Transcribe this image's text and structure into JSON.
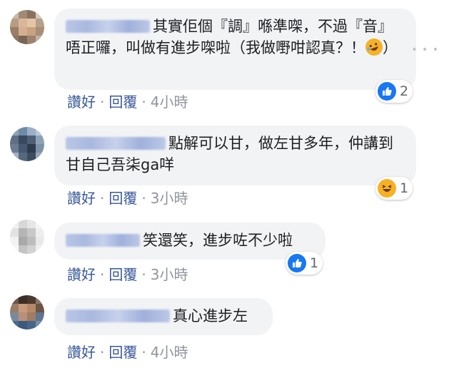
{
  "comments": [
    {
      "text": "其實佢個『調』喺準㗎，不過『音』唔正囉，叫做有進步㗎啦（我做嘢咁認真？！",
      "text_end": "）",
      "actions": {
        "like": "讚好",
        "reply": "回覆",
        "time": "4小時"
      },
      "reaction": {
        "type": "like-icon",
        "count": "2"
      }
    },
    {
      "text": "點解可以甘，做左甘多年，仲講到甘自己吾柒ga咩",
      "actions": {
        "like": "讚好",
        "reply": "回覆",
        "time": "3小時"
      },
      "reaction": {
        "type": "haha-icon",
        "count": "1"
      }
    },
    {
      "text": "笑還笑，進步咗不少啦",
      "actions": {
        "like": "讚好",
        "reply": "回覆",
        "time": "3小時"
      },
      "reaction": {
        "type": "like-icon",
        "count": "1"
      }
    },
    {
      "text": "真心進步左",
      "actions": {
        "like": "讚好",
        "reply": "回覆",
        "time": "4小時"
      }
    }
  ],
  "separator": "·",
  "colors": {
    "link": "#385898",
    "bubble": "#f2f3f5",
    "like": "#1877f2",
    "haha": "#f7b125"
  }
}
